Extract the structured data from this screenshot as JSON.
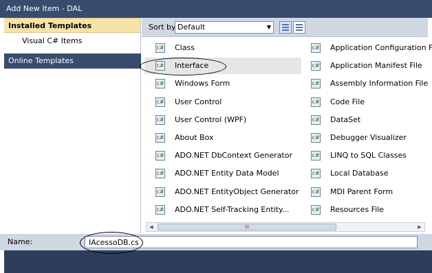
{
  "window": {
    "title": "Add New Item - DAL"
  },
  "left_pane": {
    "installed_header": "Installed Templates",
    "sub_items": [
      "Visual C# Items"
    ],
    "online_header": "Online Templates"
  },
  "sort": {
    "label": "Sort by:",
    "value": "Default"
  },
  "templates_left": [
    "Class",
    "Interface",
    "Windows Form",
    "User Control",
    "User Control (WPF)",
    "About Box",
    "ADO.NET DbContext Generator",
    "ADO.NET Entity Data Model",
    "ADO.NET EntityObject Generator",
    "ADO.NET Self-Tracking Entity..."
  ],
  "templates_right": [
    "Application Configuration File",
    "Application Manifest File",
    "Assembly Information File",
    "Code File",
    "DataSet",
    "Debugger Visualizer",
    "LINQ to SQL Classes",
    "Local Database",
    "MDI Parent Form",
    "Resources File"
  ],
  "scrollbar": {
    "grip": "III"
  },
  "name": {
    "label": "Name:",
    "value": "IAcessoDB.cs"
  },
  "selected_template": "Interface"
}
